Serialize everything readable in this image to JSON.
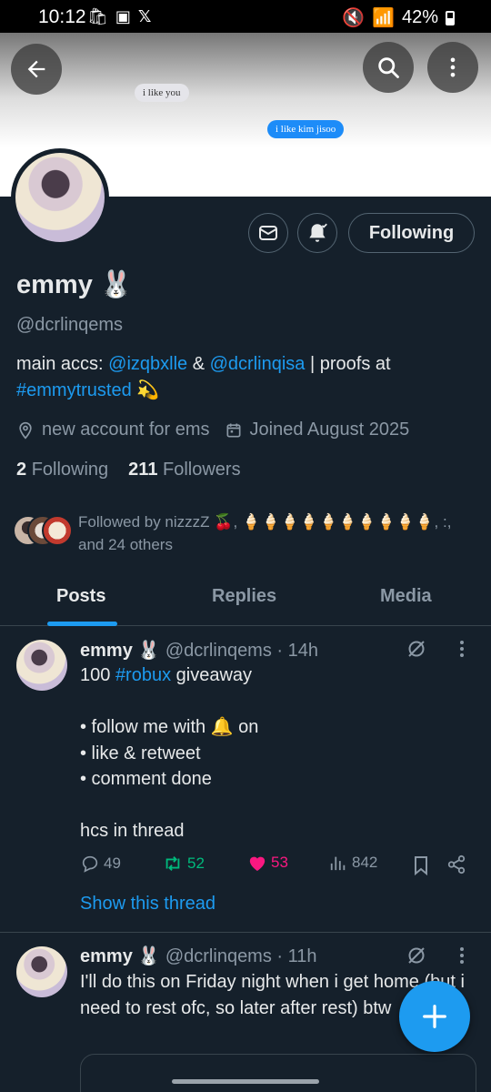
{
  "status_bar": {
    "time": "10:12",
    "battery": "42%"
  },
  "banner": {
    "bubble_left": "i like you",
    "bubble_right": "i like kim jisoo"
  },
  "profile": {
    "name": "emmy 🐰",
    "handle": "@dcrlinqems",
    "bio_prefix": "main accs: ",
    "bio_link1": "@izqbxlle",
    "bio_amp": " & ",
    "bio_link2": "@dcrlinqisa",
    "bio_mid": " | proofs at ",
    "bio_hashtag": "#emmytrusted",
    "bio_emoji": " 💫",
    "location": "new account for ems",
    "joined": "Joined August 2025",
    "following_count": "2",
    "following_label": "Following",
    "followers_count": "211",
    "followers_label": "Followers",
    "followed_by": "Followed by nizzzZ 🍒, 🍦🍦🍦🍦🍦🍦🍦🍦🍦🍦, :, and 24 others",
    "follow_button": "Following"
  },
  "tabs": [
    "Posts",
    "Replies",
    "Media"
  ],
  "posts": [
    {
      "name": "emmy 🐰",
      "handle": "@dcrlinqems",
      "time": "· 14h",
      "body_prefix": "100 ",
      "body_hashtag": "#robux",
      "body_rest": " giveaway\n\n• follow me with 🔔 on\n• like & retweet\n• comment done\n\nhcs in thread",
      "replies": "49",
      "retweets": "52",
      "likes": "53",
      "views": "842",
      "show_thread": "Show this thread"
    },
    {
      "name": "emmy 🐰",
      "handle": "@dcrlinqems",
      "time": "· 11h",
      "body": "I'll do this on Friday night when i get home (but i need to rest ofc, so later after rest) btw"
    }
  ],
  "colors": {
    "background": "#15202b",
    "accent": "#1d9bf0",
    "like": "#f91880",
    "retweet": "#00ba7c",
    "muted": "#8b98a5"
  }
}
